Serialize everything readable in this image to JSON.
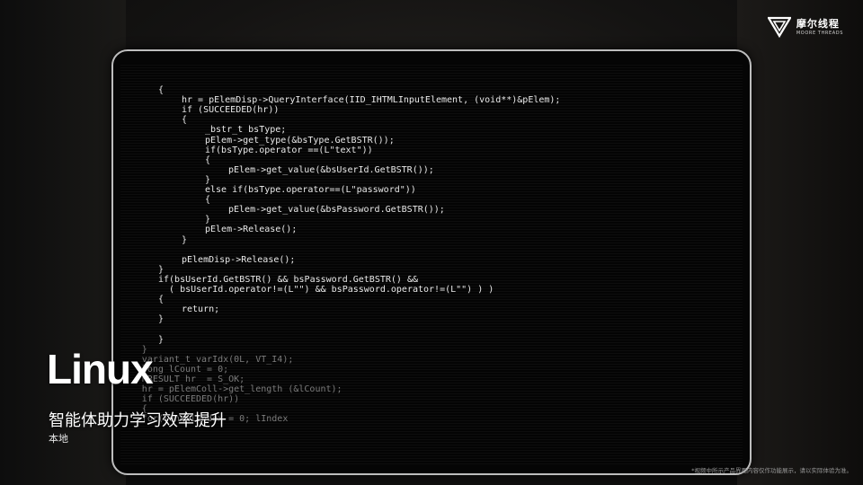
{
  "brand": {
    "logo_icon": "moore-threads-logo-icon",
    "name_cn": "摩尔线程",
    "name_en": "MOORE THREADS"
  },
  "overlay": {
    "title": "Linux",
    "subtitle": "智能体助力学习效率提升",
    "tag": "本地"
  },
  "disclaimer": "*视频中所示产品界面内容仅作功能展示，请以实际体验为准。",
  "code": {
    "lines": [
      {
        "text": "{",
        "indent": 0
      },
      {
        "text": "hr = pElemDisp->QueryInterface(IID_IHTMLInputElement, (void**)&pElem);",
        "indent": 1
      },
      {
        "text": "if (SUCCEEDED(hr))",
        "indent": 1
      },
      {
        "text": "{",
        "indent": 1
      },
      {
        "text": "_bstr_t bsType;",
        "indent": 2
      },
      {
        "text": "pElem->get_type(&bsType.GetBSTR());",
        "indent": 2
      },
      {
        "text": "if(bsType.operator ==(L\"text\"))",
        "indent": 2
      },
      {
        "text": "{",
        "indent": 2
      },
      {
        "text": "pElem->get_value(&bsUserId.GetBSTR());",
        "indent": 3
      },
      {
        "text": "}",
        "indent": 2
      },
      {
        "text": "else if(bsType.operator==(L\"password\"))",
        "indent": 2
      },
      {
        "text": "{",
        "indent": 2
      },
      {
        "text": "pElem->get_value(&bsPassword.GetBSTR());",
        "indent": 3
      },
      {
        "text": "}",
        "indent": 2
      },
      {
        "text": "pElem->Release();",
        "indent": 2
      },
      {
        "text": "}",
        "indent": 1
      },
      {
        "text": "",
        "indent": 0
      },
      {
        "text": "pElemDisp->Release();",
        "indent": 1
      },
      {
        "text": "}",
        "indent": 0
      },
      {
        "text": "if(bsUserId.GetBSTR() && bsPassword.GetBSTR() &&",
        "indent": 0
      },
      {
        "text": "  ( bsUserId.operator!=(L\"\") && bsPassword.operator!=(L\"\") ) )",
        "indent": 0
      },
      {
        "text": "{",
        "indent": 0
      },
      {
        "text": "return;",
        "indent": 1
      },
      {
        "text": "}",
        "indent": 0
      },
      {
        "text": "",
        "indent": 0
      },
      {
        "text": "}",
        "indent": 0
      },
      {
        "text": "}",
        "indent": -1
      },
      {
        "text": "variant_t varIdx(0L, VT_I4);",
        "indent": -1
      },
      {
        "text": "long lCount = 0;",
        "indent": -1
      },
      {
        "text": "HRESULT hr  = S_OK;",
        "indent": -1
      },
      {
        "text": "hr = pElemColl->get_length (&lCount);",
        "indent": -1
      },
      {
        "text": "if (SUCCEEDED(hr))",
        "indent": -1
      },
      {
        "text": "{",
        "indent": -1
      },
      {
        "text": "for(long lIndex = 0; lIndex",
        "indent": -1
      }
    ]
  }
}
